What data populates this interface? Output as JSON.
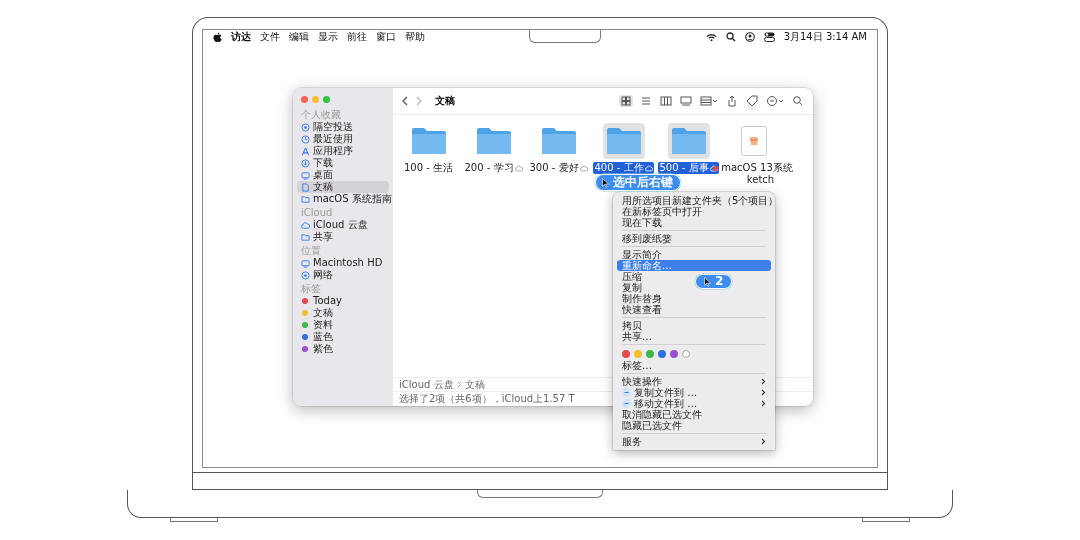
{
  "menu_bar": {
    "app": "访达",
    "menus": [
      "文件",
      "编辑",
      "显示",
      "前往",
      "窗口",
      "帮助"
    ],
    "date_time": "3月14日 3:14 AM"
  },
  "finder": {
    "title": "文稿",
    "sidebar": [
      {
        "header": "个人收藏",
        "items": [
          {
            "label": "隔空投送",
            "kind": "airdrop",
            "selected": false
          },
          {
            "label": "最近使用",
            "kind": "recent",
            "selected": false
          },
          {
            "label": "应用程序",
            "kind": "apps",
            "selected": false
          },
          {
            "label": "下载",
            "kind": "download",
            "selected": false
          },
          {
            "label": "桌面",
            "kind": "desktop",
            "selected": false
          },
          {
            "label": "文稿",
            "kind": "doc",
            "selected": true
          },
          {
            "label": "macOS 系统指南",
            "kind": "folder",
            "selected": false
          }
        ]
      },
      {
        "header": "iCloud",
        "items": [
          {
            "label": "iCloud 云盘",
            "kind": "cloud",
            "selected": false
          },
          {
            "label": "共享",
            "kind": "shared",
            "selected": false
          }
        ]
      },
      {
        "header": "位置",
        "items": [
          {
            "label": "Macintosh HD",
            "kind": "disk",
            "selected": false
          },
          {
            "label": "网络",
            "kind": "network",
            "selected": false
          }
        ]
      },
      {
        "header": "标签",
        "items": [
          {
            "label": "Today",
            "kind": "tag",
            "color": "#e5484d",
            "selected": false
          },
          {
            "label": "文稿",
            "kind": "tag",
            "color": "#f2c12e",
            "selected": false
          },
          {
            "label": "资料",
            "kind": "tag",
            "color": "#3cb94a",
            "selected": false
          },
          {
            "label": "蓝色",
            "kind": "tag",
            "color": "#2f6fe0",
            "selected": false
          },
          {
            "label": "紫色",
            "kind": "tag",
            "color": "#9a4fd1",
            "selected": false
          }
        ]
      }
    ],
    "files": [
      {
        "name": "100 - 生活",
        "kind": "folder",
        "cloud": false,
        "selected": false
      },
      {
        "name": "200 - 学习",
        "kind": "folder",
        "cloud": true,
        "selected": false
      },
      {
        "name": "300 - 爱好",
        "kind": "folder",
        "cloud": true,
        "selected": false
      },
      {
        "name": "400 - 工作",
        "kind": "folder",
        "cloud": true,
        "selected": true
      },
      {
        "name": "500 - 后事",
        "kind": "folder",
        "cloud": true,
        "selected": true
      },
      {
        "name": "macOS 13系统",
        "name_line_2": "ketch",
        "kind": "document",
        "cloud": false,
        "selected": false,
        "color": "#e5484d"
      }
    ],
    "path": [
      "iCloud 云盘",
      "文稿"
    ],
    "status": "选择了2项（共6项），iCloud上1.57 T"
  },
  "context_menu": {
    "groups": [
      [
        {
          "label": "用所选项目新建文件夹（5个项目）",
          "kind": "item",
          "submenu": false,
          "selected": false
        },
        {
          "label": "在新标签页中打开",
          "kind": "item",
          "submenu": false,
          "selected": false
        },
        {
          "label": "现在下载",
          "kind": "item",
          "submenu": false,
          "selected": false
        }
      ],
      [
        {
          "label": "移到废纸篓",
          "kind": "item",
          "submenu": false,
          "selected": false
        }
      ],
      [
        {
          "label": "显示简介",
          "kind": "item",
          "submenu": false,
          "selected": false
        },
        {
          "label": "重新命名…",
          "kind": "item",
          "submenu": false,
          "selected": true
        },
        {
          "label": "压缩",
          "kind": "item",
          "submenu": false,
          "selected": false
        },
        {
          "label": "复制",
          "kind": "item",
          "submenu": false,
          "selected": false
        },
        {
          "label": "制作替身",
          "kind": "item",
          "submenu": false,
          "selected": false
        },
        {
          "label": "快速查看",
          "kind": "item",
          "submenu": false,
          "selected": false
        }
      ],
      [
        {
          "label": "拷贝",
          "kind": "item",
          "submenu": false,
          "selected": false
        },
        {
          "label": "共享…",
          "kind": "item",
          "submenu": false,
          "selected": false
        }
      ],
      [
        {
          "kind": "colors",
          "colors": [
            {
              "color": "#e5484d"
            },
            {
              "color": "#f2c12e"
            },
            {
              "color": "#3cb94a"
            },
            {
              "color": "#2f6fe0"
            },
            {
              "color": "#9a4fd1"
            }
          ],
          "none_option": true
        },
        {
          "label": "标签…",
          "kind": "item",
          "submenu": false,
          "selected": false
        }
      ],
      [
        {
          "label": "快速操作",
          "kind": "item",
          "submenu": true,
          "selected": false
        },
        {
          "label": "复制文件到 …",
          "kind": "action",
          "submenu": true,
          "selected": false
        },
        {
          "label": "移动文件到 …",
          "kind": "action",
          "submenu": true,
          "selected": false
        },
        {
          "label": "取消隐藏已选文件",
          "kind": "item",
          "submenu": false,
          "selected": false
        },
        {
          "label": "隐藏已选文件",
          "kind": "item",
          "submenu": false,
          "selected": false
        }
      ],
      [
        {
          "label": "服务",
          "kind": "item",
          "submenu": true,
          "selected": false
        }
      ]
    ]
  },
  "callouts": [
    {
      "text": "选中后右键"
    },
    {
      "text": "2"
    }
  ]
}
